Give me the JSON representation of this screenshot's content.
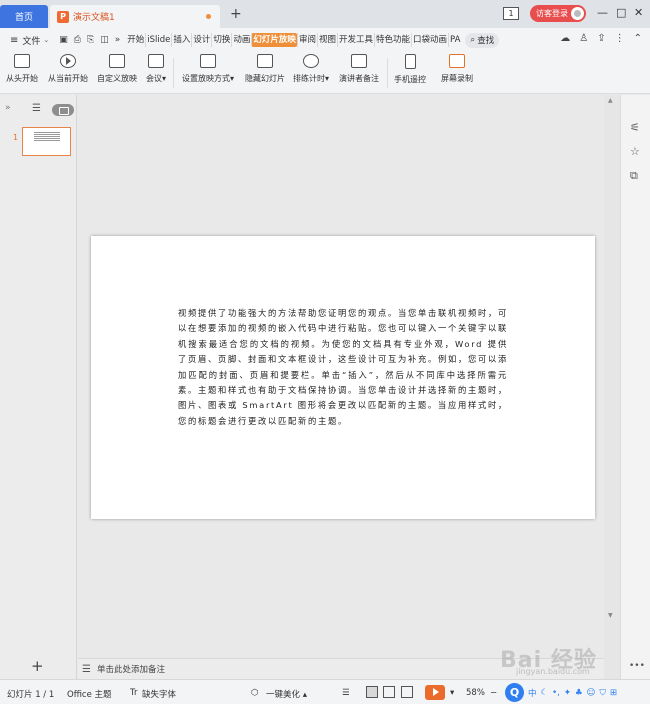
{
  "titlebar": {
    "home_tab": "首页",
    "doc_icon": "P",
    "doc_title": "演示文稿1",
    "add_tab": "+",
    "badge": "1",
    "login": "访客登录",
    "minimize": "—",
    "maximize": "□",
    "close": "✕"
  },
  "menubar": {
    "menu_icon": "≡",
    "file": "文件",
    "tabs": [
      "开始",
      "iSlide",
      "插入",
      "设计",
      "切换",
      "动画",
      "幻灯片放映",
      "审阅",
      "视图",
      "开发工具",
      "特色功能",
      "口袋动画",
      "PA"
    ],
    "search": "查找"
  },
  "ribbon": {
    "from_start": "从头开始",
    "from_current": "从当前开始",
    "custom_show": "自定义放映",
    "meeting": "会议",
    "setup_show": "设置放映方式",
    "hide_slide": "隐藏幻灯片",
    "rehearse": "排练计时",
    "presenter_notes": "演讲者备注",
    "phone_remote": "手机遥控",
    "screen_record": "屏幕录制",
    "caret": "▾"
  },
  "leftpane": {
    "slide_number": "1",
    "add": "+"
  },
  "slide": {
    "body": "视频提供了功能强大的方法帮助您证明您的观点。当您单击联机视频时，可以在想要添加的视频的嵌入代码中进行粘贴。您也可以键入一个关键字以联机搜索最适合您的文档的视频。为使您的文档具有专业外观，Word 提供了页眉、页脚、封面和文本框设计，这些设计可互为补充。例如，您可以添加匹配的封面、页眉和提要栏。单击“插入”，然后从不同库中选择所需元素。主题和样式也有助于文档保持协调。当您单击设计并选择新的主题时，图片、图表或 SmartArt 图形将会更改以匹配新的主题。当应用样式时，您的标题会进行更改以匹配新的主题。"
  },
  "notes": {
    "placeholder": "单击此处添加备注"
  },
  "status": {
    "slide_count": "幻灯片 1 / 1",
    "theme": "Office 主题",
    "missing_font": "缺失字体",
    "beautify": "一键美化",
    "zoom": "58%",
    "ime_logo": "Q",
    "ime_mode": "中"
  },
  "watermark": {
    "text": "Bai 经验",
    "url": "jingyan.baidu.com"
  }
}
